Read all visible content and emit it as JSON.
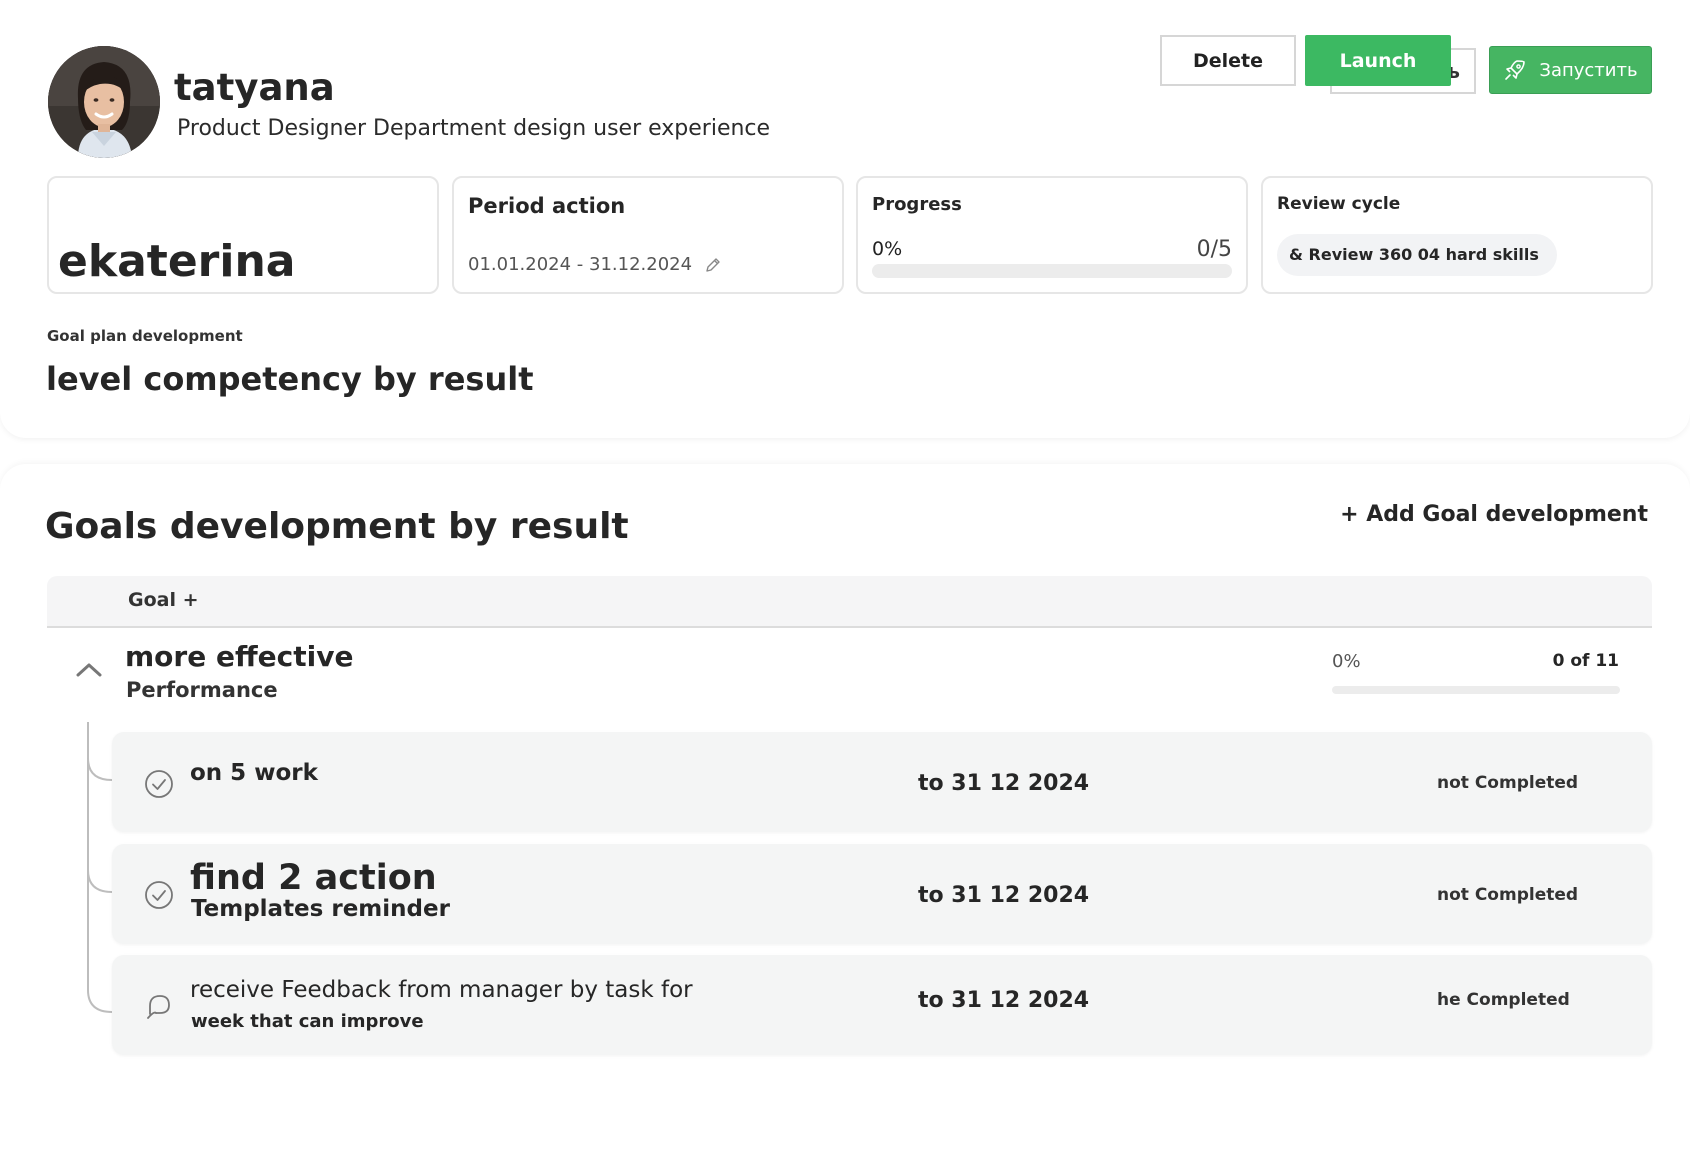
{
  "header": {
    "user_name": "tatyana",
    "user_role": "Product Designer Department design user experience",
    "actions": {
      "ghost_label": "ь",
      "delete_label": "Delete",
      "launch_label": "Launch",
      "run_label": "Запустить"
    }
  },
  "stats": {
    "name_card": {
      "value": "ekaterina"
    },
    "period": {
      "title": "Period action",
      "dates": "01.01.2024 - 31.12.2024"
    },
    "progress": {
      "title": "Progress",
      "percent_label": "0%",
      "count": "0/5",
      "fraction": 0
    },
    "review": {
      "title": "Review cycle",
      "chip": "& Review 360 04 hard skills"
    }
  },
  "plan": {
    "label": "Goal plan development",
    "title": "level competency by result"
  },
  "goals": {
    "title": "Goals development by result",
    "add_label": "+ Add Goal development",
    "table_header": {
      "goal_col": "Goal +"
    },
    "group": {
      "title": "more effective",
      "subtitle": "Performance",
      "percent_label": "0%",
      "count": "0 of 11",
      "fraction": 0
    },
    "tasks": [
      {
        "title": "on 5 work",
        "subtitle": "",
        "due": "to 31 12 2024",
        "status": "not Completed",
        "icon": "check-circle-icon"
      },
      {
        "title": "find 2 action",
        "subtitle": "Templates reminder",
        "due": "to 31 12 2024",
        "status": "not Completed",
        "icon": "check-circle-icon"
      },
      {
        "title": "receive Feedback from manager by task for",
        "subtitle": "week that can improve",
        "due": "to 31 12 2024",
        "status": "he Completed",
        "icon": "chat-bubble-icon"
      }
    ]
  },
  "colors": {
    "accent_green": "#3cb962",
    "text_dark": "#262626",
    "row_bg": "#f4f5f5"
  }
}
